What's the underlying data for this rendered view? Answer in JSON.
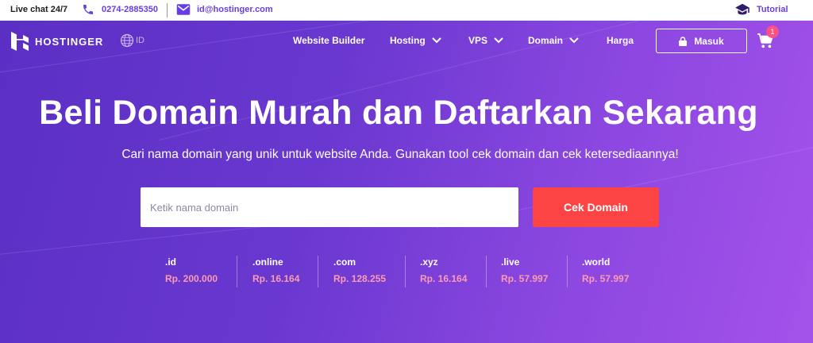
{
  "topbar": {
    "live_chat": "Live chat 24/7",
    "phone": "0274-2885350",
    "email": "id@hostinger.com",
    "tutorial": "Tutorial",
    "accent_color": "#673de6"
  },
  "nav": {
    "logo_text": "HOSTINGER",
    "lang": "ID",
    "items": [
      {
        "label": "Website Builder",
        "has_dropdown": false
      },
      {
        "label": "Hosting",
        "has_dropdown": true
      },
      {
        "label": "VPS",
        "has_dropdown": true
      },
      {
        "label": "Domain",
        "has_dropdown": true
      },
      {
        "label": "Harga",
        "has_dropdown": false
      }
    ],
    "login_label": "Masuk",
    "cart_count": "1",
    "icons": {
      "logo": "hostinger-logo-icon",
      "globe": "globe-icon",
      "lock": "lock-icon",
      "cart": "cart-icon"
    }
  },
  "hero": {
    "headline": "Beli Domain Murah dan Daftarkan Sekarang",
    "subheadline": "Cari nama domain yang unik untuk website Anda. Gunakan tool cek domain dan cek ketersediaannya!",
    "search_placeholder": "Ketik nama domain",
    "search_value": "",
    "search_button": "Cek Domain",
    "button_color": "#fc4444",
    "gradient_start": "#5b2fc4",
    "gradient_end": "#a452ea"
  },
  "tlds": [
    {
      "name": ".id",
      "price": "Rp. 200.000"
    },
    {
      "name": ".online",
      "price": "Rp. 16.164"
    },
    {
      "name": ".com",
      "price": "Rp. 128.255"
    },
    {
      "name": ".xyz",
      "price": "Rp. 16.164"
    },
    {
      "name": ".live",
      "price": "Rp. 57.997"
    },
    {
      "name": ".world",
      "price": "Rp. 57.997"
    }
  ]
}
